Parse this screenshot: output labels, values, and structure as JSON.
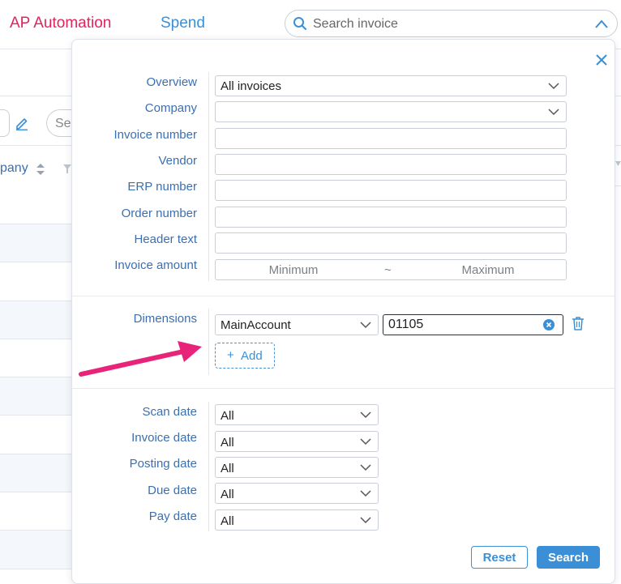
{
  "nav": {
    "tabs": [
      {
        "label": "AP Automation"
      },
      {
        "label": "Spend"
      }
    ]
  },
  "search": {
    "placeholder": "Search invoice"
  },
  "background": {
    "search_fragment": "Se",
    "column_header": "pany"
  },
  "panel": {
    "fields": [
      {
        "label": "Overview",
        "value": "All invoices"
      },
      {
        "label": "Company",
        "value": ""
      },
      {
        "label": "Invoice number",
        "value": ""
      },
      {
        "label": "Vendor",
        "value": ""
      },
      {
        "label": "ERP number",
        "value": ""
      },
      {
        "label": "Order number",
        "value": ""
      },
      {
        "label": "Header text",
        "value": ""
      },
      {
        "label": "Invoice amount",
        "min_placeholder": "Minimum",
        "separator": "~",
        "max_placeholder": "Maximum"
      }
    ],
    "dimensions": {
      "label": "Dimensions",
      "select_value": "MainAccount",
      "input_value": "01105",
      "add_label": "Add",
      "add_symbol": "+"
    },
    "dates": [
      {
        "label": "Scan date",
        "value": "All"
      },
      {
        "label": "Invoice date",
        "value": "All"
      },
      {
        "label": "Posting date",
        "value": "All"
      },
      {
        "label": "Due date",
        "value": "All"
      },
      {
        "label": "Pay date",
        "value": "All"
      }
    ],
    "buttons": {
      "reset": "Reset",
      "search": "Search"
    }
  },
  "colors": {
    "brand_pink": "#e0245e",
    "accent_blue": "#3b8fd6",
    "label_blue": "#3b6fb0",
    "annotation_arrow": "#e8247a"
  },
  "icons": [
    "search-icon",
    "chevron-up-icon",
    "close-icon",
    "chevron-down-icon",
    "clear-icon",
    "trash-icon",
    "pencil-icon",
    "sort-icon",
    "filter-icon"
  ]
}
